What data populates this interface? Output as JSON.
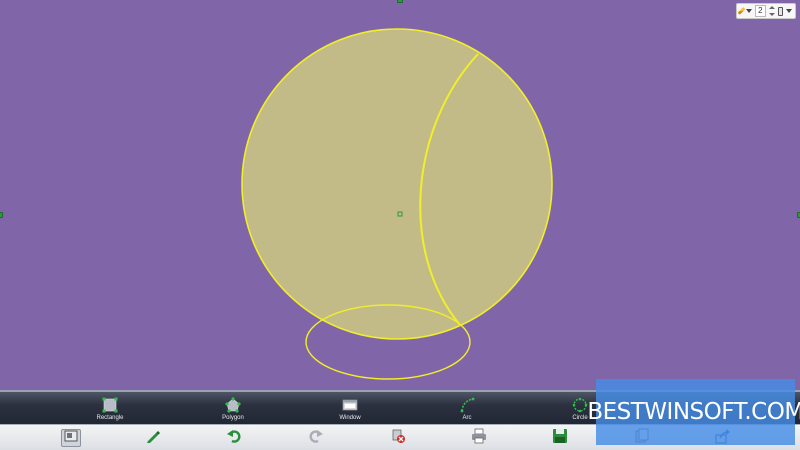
{
  "canvas": {
    "background": "#8066a8",
    "shape_fill": "#c2bb87",
    "shape_stroke": "#f1ee2a"
  },
  "pen_widget": {
    "pen_icon": "pencil-icon",
    "size_value": "2",
    "eraser_icon": "eraser-icon"
  },
  "shape_toolbar": {
    "items": [
      {
        "label": "Rectangle",
        "icon": "rectangle-icon"
      },
      {
        "label": "Polygon",
        "icon": "polygon-icon"
      },
      {
        "label": "Window",
        "icon": "window-icon"
      },
      {
        "label": "Arc",
        "icon": "arc-icon"
      },
      {
        "label": "Circle",
        "icon": "circle-icon"
      }
    ]
  },
  "action_toolbar": {
    "items": [
      {
        "icon": "select-capture-icon"
      },
      {
        "icon": "pen-icon"
      },
      {
        "icon": "undo-icon"
      },
      {
        "icon": "redo-icon"
      },
      {
        "icon": "clear-icon"
      },
      {
        "icon": "print-icon"
      },
      {
        "icon": "save-icon"
      },
      {
        "icon": "copy-icon"
      },
      {
        "icon": "share-icon"
      }
    ]
  },
  "watermark": {
    "text": "BESTWINSOFT.COM"
  }
}
